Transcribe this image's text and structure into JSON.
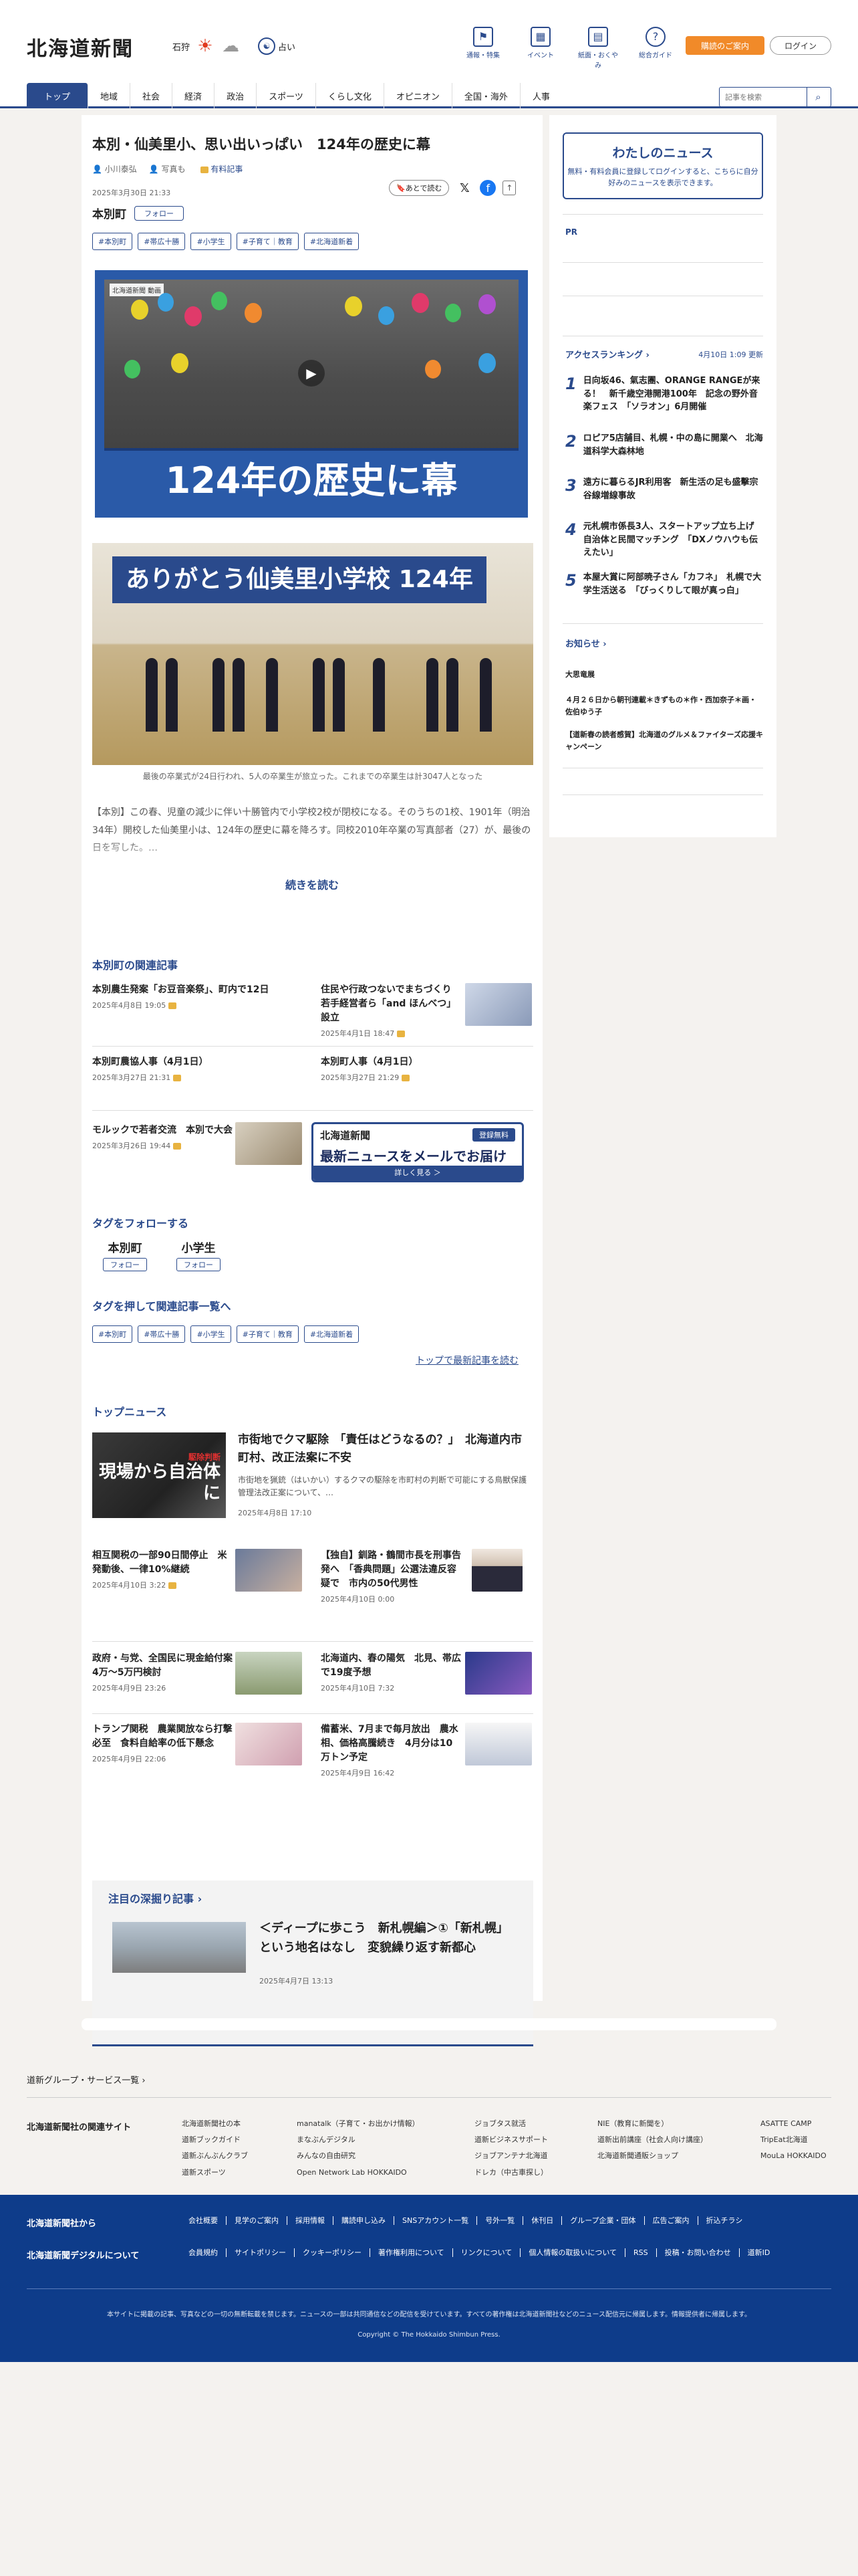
{
  "header": {
    "logo": "北海道新聞",
    "location": "石狩",
    "fortune_label": "占い",
    "icons": [
      {
        "label": "通報・特集",
        "icon": "flag-icon"
      },
      {
        "label": "イベント",
        "icon": "calendar-icon"
      },
      {
        "label": "紙面・おくやみ",
        "icon": "newspaper-icon"
      },
      {
        "label": "総合ガイド",
        "icon": "question-icon"
      }
    ],
    "member_button": "購読のご案内",
    "login_button": "ログイン"
  },
  "nav": {
    "items": [
      "トップ",
      "地域",
      "社会",
      "経済",
      "政治",
      "スポーツ",
      "くらし文化",
      "オピニオン",
      "全国・海外",
      "人事"
    ],
    "search_placeholder": "記事を検索"
  },
  "article": {
    "title": "本別・仙美里小、思い出いっぱい　124年の歴史に幕",
    "author": "小川泰弘",
    "photo_credit": "写真も",
    "paid_badge": "有料記事",
    "date": "2025年3月30日 21:33",
    "read_later": "あとで読む",
    "place": "本別町",
    "follow": "フォロー",
    "tags": [
      "#本別町",
      "#帯広十勝",
      "#小学生",
      "#子育て｜教育",
      "#北海道新着"
    ],
    "video_label": "北海道新聞 動画",
    "video_caption": "124年の歴史に幕",
    "photo_banner": "ありがとう仙美里小学校 124年",
    "photo_caption": "最後の卒業式が24日行われ、5人の卒業生が旅立った。これまでの卒業生は計3047人となった",
    "body": "【本別】この春、児童の減少に伴い十勝管内で小学校2校が閉校になる。そのうちの1校、1901年（明治34年）開校した仙美里小は、124年の歴史に幕を降ろす。同校2010年卒業の写真部者（27）が、最後の日を写した。…",
    "read_more": "続きを読む"
  },
  "related": {
    "heading": "本別町の関連記事",
    "items": [
      {
        "title": "本別農生発案「お豆音楽祭」、町内で12日",
        "date": "2025年4月8日 19:05"
      },
      {
        "title": "住民や行政つないでまちづくり　若手経営者ら「and ほんべつ」設立",
        "date": "2025年4月1日 18:47"
      },
      {
        "title": "本別町農協人事（4月1日）",
        "date": "2025年3月27日 21:31"
      },
      {
        "title": "本別町人事（4月1日）",
        "date": "2025年3月27日 21:29"
      },
      {
        "title": "モルックで若者交流　本別で大会",
        "date": "2025年3月26日 19:44"
      }
    ]
  },
  "promo": {
    "logo": "北海道新聞",
    "free": "登録無料",
    "main": "最新ニュースをメールでお届け",
    "more": "詳しく見る ＞"
  },
  "follow_tags": {
    "heading": "タグをフォローする",
    "items": [
      {
        "name": "本別町",
        "button": "フォロー"
      },
      {
        "name": "小学生",
        "button": "フォロー"
      }
    ],
    "list_heading": "タグを押して関連記事一覧へ",
    "tags": [
      "#本別町",
      "#帯広十勝",
      "#小学生",
      "#子育て｜教育",
      "#北海道新着"
    ],
    "latest_link": "トップで最新記事を読む"
  },
  "top_news": {
    "heading": "トップニュース",
    "main": {
      "title": "市街地でクマ駆除　「責任はどうなるの？」　北海道内市町村、改正法案に不安",
      "desc": "市街地を猟銃（はいかい）するクマの駆除を市町村の判断で可能にする鳥獣保護管理法改正案について、…",
      "date": "2025年4月8日 17:10",
      "img_tag": "駆除判断",
      "img_text": "現場から自治体に"
    },
    "items": [
      {
        "title": "相互関税の一部90日間停止　米発動後、一律10%継続",
        "date": "2025年4月10日 3:22"
      },
      {
        "title": "【独自】釧路・鶴間市長を刑事告発へ　「香典問題」公選法違反容疑で　市内の50代男性",
        "date": "2025年4月10日 0:00"
      },
      {
        "title": "政府・与党、全国民に現金給付案　4万〜5万円検討",
        "date": "2025年4月9日 23:26"
      },
      {
        "title": "北海道内、春の陽気　北見、帯広で19度予想",
        "date": "2025年4月10日 7:32"
      },
      {
        "title": "トランプ関税　農業関放なら打撃必至　食料自給率の低下懸念",
        "date": "2025年4月9日 22:06"
      },
      {
        "title": "備蓄米、7月まで毎月放出　農水相、価格高騰続き　4月分は10万トン予定",
        "date": "2025年4月9日 16:42"
      }
    ]
  },
  "deep": {
    "heading": "注目の深掘り記事",
    "title": "＜ディープに歩こう　新札幌編＞①「新札幌」という地名はなし　変貌繰り返す新都心",
    "date": "2025年4月7日 13:13"
  },
  "sidebar": {
    "mynews_title": "わたしのニュース",
    "mynews_text": "無料・有料会員に登録してログインすると、こちらに自分好みのニュースを表示できます。",
    "pr": "PR",
    "ranking_heading": "アクセスランキング",
    "ranking_date": "4月10日 1:09 更新",
    "ranking": [
      "日向坂46、氣志團、ORANGE RANGEが来る！　新千歳空港開港100年　記念の野外音楽フェス　「ソラオン」6月開催",
      "ロピア5店舗目、札幌・中の島に開業へ　北海道科学大森林地",
      "遠方に暮らるJR利用客　新生活の足も盛擊宗谷線増線事故",
      "元札幌市係長3人、スタートアップ立ち上げ　自治体と民間マッチング　「DXノウハウも伝えたい」",
      "本屋大賞に阿部暁子さん「カフネ」　札幌で大学生活送る　「びっくりして眼が真っ白」"
    ],
    "notice_heading": "お知らせ",
    "notices": [
      "大思竜展",
      "４月２６日から朝刊連載＊きずもの＊作・西加奈子＊画・佐伯ゆう子",
      "【道新春の読者感賀】北海道のグルメ＆ファイターズ応援キャンペーン"
    ]
  },
  "footer": {
    "group_link": "道新グループ・サービス一覧",
    "related_sites": "北海道新聞社の関連サイト",
    "cols": [
      [
        "北海道新聞社の本",
        "道新ブックガイド",
        "道新ぶんぶんクラブ",
        "道新スポーツ"
      ],
      [
        "manatalk（子育て・お出かけ情報）",
        "まなぶんデジタル",
        "みんなの自由研究",
        "Open Network Lab HOKKAIDO"
      ],
      [
        "ジョブタス就活",
        "道新ビジネスサポート",
        "ジョブアンテナ北海道",
        "ドレカ（中古車探し）"
      ],
      [
        "NIE（教育に新聞を）",
        "道新出前講座（社会人向け講座）",
        "北海道新聞通販ショップ"
      ],
      [
        "ASATTE CAMP",
        "TripEat北海道",
        "MouLa HOKKAIDO"
      ]
    ],
    "blue_h1": "北海道新聞社から",
    "blue_h2": "北海道新聞デジタルについて",
    "links1": [
      "会社概要",
      "見学のご案内",
      "採用情報",
      "購読申し込み",
      "SNSアカウント一覧",
      "号外一覧",
      "休刊日",
      "グループ企業・団体",
      "広告ご案内",
      "折込チラシ"
    ],
    "links2": [
      "会員規約",
      "サイトポリシー",
      "クッキーポリシー",
      "著作権利用について",
      "リンクについて",
      "個人情報の取扱いについて",
      "RSS",
      "投稿・お問い合わせ",
      "道新ID"
    ],
    "note": "本サイトに掲載の記事、写真などの一切の無断転載を禁じます。ニュースの一部は共同通信などの配信を受けています。すべての著作権は北海道新聞社などのニュース配信元に帰属します。情報提供者に帰属します。",
    "copyright": "Copyright © The Hokkaido Shimbun Press."
  }
}
